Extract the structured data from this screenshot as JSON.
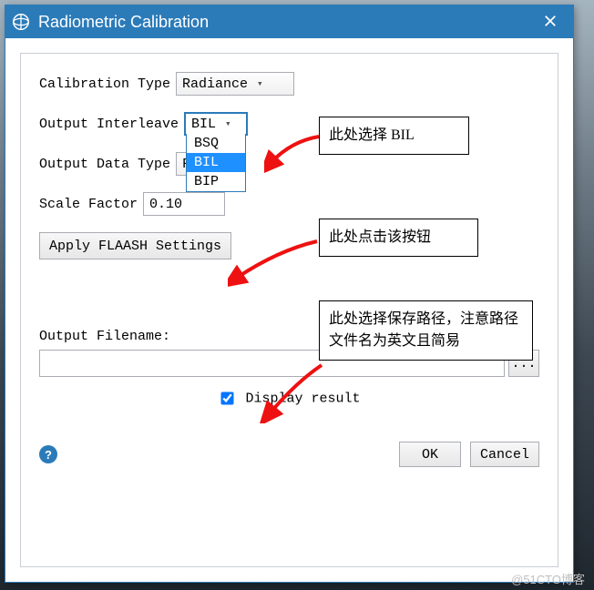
{
  "window": {
    "title": "Radiometric Calibration"
  },
  "fields": {
    "calibration_type_label": "Calibration Type",
    "calibration_type_value": "Radiance",
    "interleave_label": "Output Interleave",
    "interleave_value": "BIL",
    "interleave_options": [
      "BSQ",
      "BIL",
      "BIP"
    ],
    "data_type_label": "Output Data Type",
    "data_type_value_truncated": "F",
    "scale_factor_label": "Scale Factor",
    "scale_factor_value": "0.10",
    "apply_flaash_label": "Apply FLAASH Settings",
    "output_filename_label": "Output Filename:",
    "output_filename_value": "",
    "browse_label": "...",
    "display_result_label": "Display result",
    "display_result_checked": true,
    "ok_label": "OK",
    "cancel_label": "Cancel"
  },
  "annotations": {
    "a1": "此处选择 BIL",
    "a2": "此处点击该按钮",
    "a3": "此处选择保存路径，注意路径文件名为英文且简易"
  },
  "watermark": "@51CTO博客"
}
